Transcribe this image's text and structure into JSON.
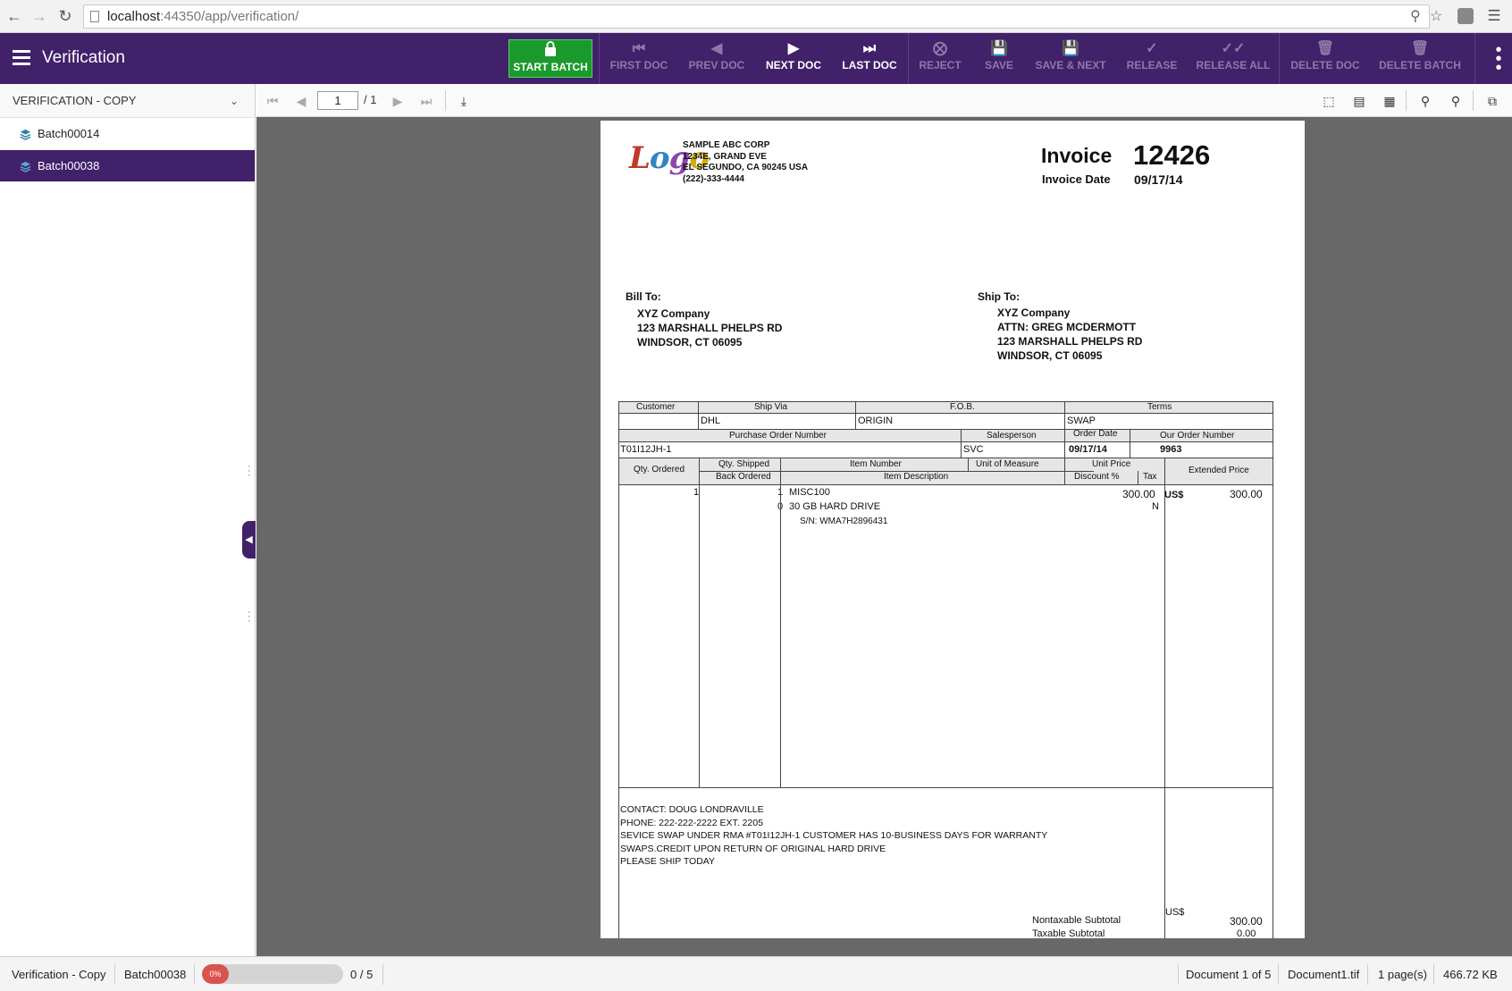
{
  "browser": {
    "url_host": "localhost",
    "url_path": ":44350/app/verification/"
  },
  "appbar": {
    "title": "Verification",
    "buttons": {
      "start_batch": "START BATCH",
      "first_doc": "FIRST DOC",
      "prev_doc": "PREV DOC",
      "next_doc": "NEXT DOC",
      "last_doc": "LAST DOC",
      "reject": "REJECT",
      "save": "SAVE",
      "save_next": "SAVE & NEXT",
      "release": "RELEASE",
      "release_all": "RELEASE ALL",
      "delete_doc": "DELETE DOC",
      "delete_batch": "DELETE BATCH"
    },
    "accent": "#41216a",
    "start_color": "#1a9a2c"
  },
  "sidebar": {
    "header": "VERIFICATION - COPY",
    "items": [
      {
        "label": "Batch00014"
      },
      {
        "label": "Batch00038"
      }
    ]
  },
  "viewer": {
    "page_input": "1",
    "page_total": "/ 1"
  },
  "invoice": {
    "company": [
      "SAMPLE ABC CORP",
      "1234E, GRAND EVE",
      "EL SEGUNDO, CA 90245 USA",
      "(222)-333-4444"
    ],
    "title": "Invoice",
    "number": "12426",
    "date_label": "Invoice Date",
    "date": "09/17/14",
    "bill_to_label": "Bill To:",
    "bill_to": [
      "XYZ Company",
      "123 MARSHALL PHELPS RD",
      "WINDSOR, CT 06095"
    ],
    "ship_to_label": "Ship To:",
    "ship_to": [
      "XYZ Company",
      "ATTN: GREG MCDERMOTT",
      "123 MARSHALL PHELPS RD",
      "WINDSOR, CT 06095"
    ],
    "headers1": {
      "customer": "Customer",
      "ship_via": "Ship Via",
      "fob": "F.O.B.",
      "terms": "Terms"
    },
    "row1": {
      "ship_via": "DHL",
      "fob": "ORIGIN",
      "terms": "SWAP"
    },
    "headers2": {
      "po": "Purchase Order Number",
      "salesperson": "Salesperson",
      "order_date": "Order Date",
      "our_order": "Our Order Number"
    },
    "row2": {
      "po": "T01I12JH-1",
      "salesperson": "SVC",
      "order_date": "09/17/14",
      "our_order": "9963"
    },
    "headers3": {
      "qty_ordered": "Qty. Ordered",
      "qty_shipped": "Qty. Shipped",
      "back_ordered": "Back Ordered",
      "item_number": "Item Number",
      "uom": "Unit of Measure",
      "item_desc": "Item Description",
      "unit_price": "Unit Price",
      "discount": "Discount %",
      "tax": "Tax",
      "extended": "Extended Price"
    },
    "line": {
      "qty_ordered": "1",
      "qty_shipped": "1",
      "back_ordered": "0",
      "item_number": "MISC100",
      "desc1": "30 GB HARD DRIVE",
      "desc2": "S/N: WMA7H2896431",
      "unit_price": "300.00",
      "tax": "N",
      "currency": "US$",
      "extended": "300.00"
    },
    "notes": [
      "CONTACT: DOUG LONDRAVILLE",
      "PHONE:  222-222-2222 EXT. 2205",
      "SEVICE SWAP UNDER RMA #T01I12JH-1 CUSTOMER HAS 10-BUSINESS DAYS FOR WARRANTY",
      "SWAPS.CREDIT UPON RETURN OF ORIGINAL HARD DRIVE",
      "PLEASE SHIP TODAY"
    ],
    "nontax_label": "Nontaxable Subtotal",
    "tax_label": "Taxable Subtotal",
    "subtotal_currency": "US$",
    "nontax_value": "300.00",
    "tax_value": "0.00"
  },
  "status": {
    "batch_class": "Verification - Copy",
    "batch_name": "Batch00038",
    "progress_text": "0%",
    "progress_fraction": 0,
    "count": "0 / 5",
    "document": "Document 1 of 5",
    "filename": "Document1.tif",
    "pages": "1 page(s)",
    "size": "466.72 KB"
  }
}
